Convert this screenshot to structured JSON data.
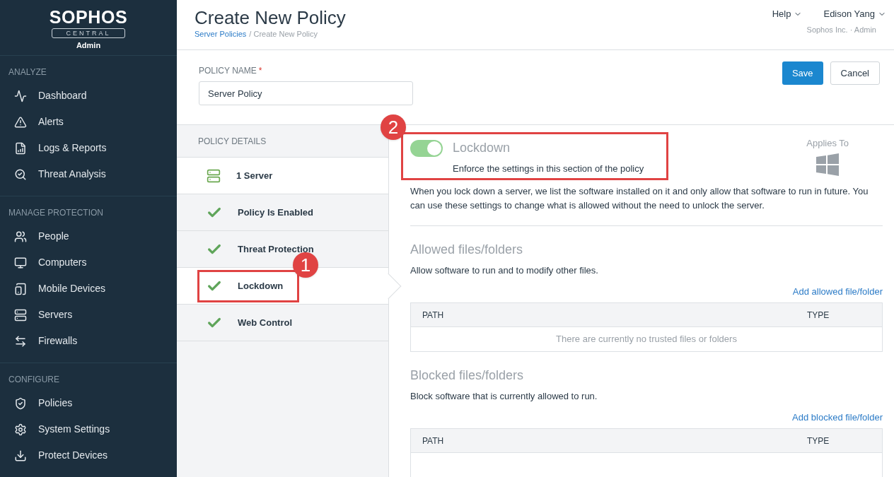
{
  "brand": {
    "logo": "SOPHOS",
    "product": "CENTRAL",
    "role": "Admin"
  },
  "sidebar": {
    "sections": [
      {
        "title": "ANALYZE",
        "items": [
          {
            "label": "Dashboard"
          },
          {
            "label": "Alerts"
          },
          {
            "label": "Logs & Reports"
          },
          {
            "label": "Threat Analysis"
          }
        ]
      },
      {
        "title": "MANAGE PROTECTION",
        "items": [
          {
            "label": "People"
          },
          {
            "label": "Computers"
          },
          {
            "label": "Mobile Devices"
          },
          {
            "label": "Servers"
          },
          {
            "label": "Firewalls"
          }
        ]
      },
      {
        "title": "CONFIGURE",
        "items": [
          {
            "label": "Policies"
          },
          {
            "label": "System Settings"
          },
          {
            "label": "Protect Devices"
          }
        ]
      }
    ]
  },
  "header": {
    "title": "Create New Policy",
    "breadcrumb": [
      {
        "label": "Server Policies",
        "kind": "link"
      },
      {
        "label": "/ Create New Policy",
        "kind": "current"
      }
    ],
    "help": "Help",
    "user": "Edison Yang",
    "account": "Sophos Inc. · Admin"
  },
  "policy_name": {
    "label": "POLICY NAME",
    "required_mark": "*",
    "value": "Server Policy"
  },
  "buttons": [
    {
      "label": "Save",
      "kind": "primary"
    },
    {
      "label": "Cancel",
      "kind": "secondary"
    }
  ],
  "details": {
    "title": "POLICY DETAILS",
    "items": [
      {
        "label": "1 Server",
        "kind": "server",
        "selected": false,
        "highlighted": false
      },
      {
        "label": "Policy Is Enabled",
        "kind": "check",
        "selected": false,
        "highlighted": false
      },
      {
        "label": "Threat Protection",
        "kind": "check",
        "selected": false,
        "highlighted": false
      },
      {
        "label": "Lockdown",
        "kind": "check",
        "selected": true,
        "highlighted": true
      },
      {
        "label": "Web Control",
        "kind": "check",
        "selected": false,
        "highlighted": false
      }
    ]
  },
  "callouts": [
    {
      "number": "1"
    },
    {
      "number": "2"
    }
  ],
  "section": {
    "title": "Lockdown",
    "on": true,
    "highlighted": true,
    "subtitle": "Enforce the settings in this section of the policy",
    "applies_to": "Applies To",
    "description": "When you lock down a server, we list the software installed on it and only allow that software to run in future. You can use these settings to change what is allowed without the need to unlock the server."
  },
  "lists": [
    {
      "title": "Allowed files/folders",
      "description": "Allow software to run and to modify other files.",
      "add_link": "Add allowed file/folder",
      "columns": [
        "PATH",
        "TYPE"
      ],
      "empty_text": "There are currently no trusted files or folders"
    },
    {
      "title": "Blocked files/folders",
      "description": "Block software that is currently allowed to run.",
      "add_link": "Add blocked file/folder",
      "columns": [
        "PATH",
        "TYPE"
      ]
    }
  ]
}
